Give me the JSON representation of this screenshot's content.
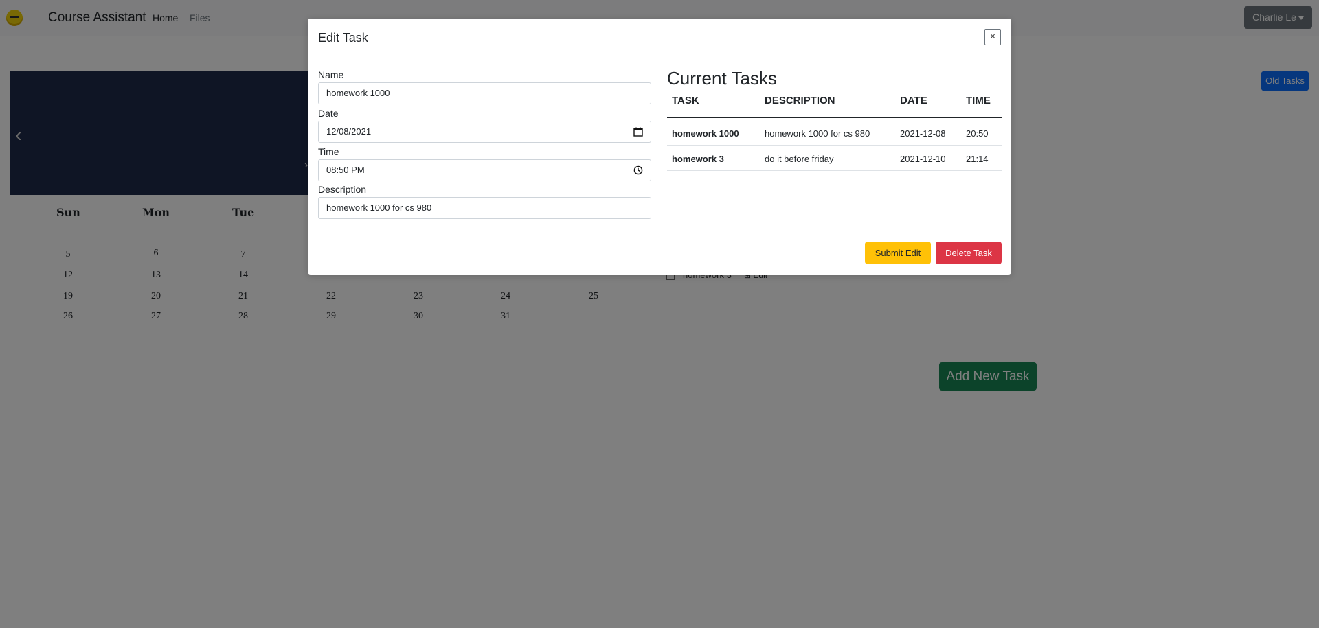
{
  "navbar": {
    "brand": "Course Assistant",
    "links": [
      "Home",
      "Files"
    ],
    "user": "Charlie Le"
  },
  "page": {
    "old_tasks_label": "Old Tasks",
    "add_task_label": "Add New Task",
    "prev_arrow": "‹",
    "next_arrow": "›",
    "calendar": {
      "weekdays": [
        "Sun",
        "Mon",
        "Tue"
      ],
      "days": [
        "5",
        "6",
        "7",
        "12",
        "13",
        "14",
        "19",
        "20",
        "21",
        "22",
        "23",
        "24",
        "25",
        "26",
        "27",
        "28",
        "29",
        "30",
        "31"
      ]
    },
    "behind_task": {
      "name": "homework 3",
      "edit_label": "Edit"
    }
  },
  "modal": {
    "title": "Edit Task",
    "close_label": "×",
    "fields": {
      "name": {
        "label": "Name",
        "value": "homework 1000"
      },
      "date": {
        "label": "Date",
        "value": "12/08/2021"
      },
      "time": {
        "label": "Time",
        "value": "08:50 PM"
      },
      "description": {
        "label": "Description",
        "value": "homework 1000 for cs 980"
      }
    },
    "current_tasks": {
      "title": "Current Tasks",
      "columns": [
        "TASK",
        "DESCRIPTION",
        "DATE",
        "TIME"
      ],
      "rows": [
        {
          "task": "homework 1000",
          "description": "homework 1000 for cs 980",
          "date": "2021-12-08",
          "time": "20:50"
        },
        {
          "task": "homework 3",
          "description": "do it before friday",
          "date": "2021-12-10",
          "time": "21:14"
        }
      ]
    },
    "submit_label": "Submit Edit",
    "delete_label": "Delete Task"
  },
  "colors": {
    "submit": "#ffc107",
    "delete": "#dc3545",
    "add_task": "#198754",
    "old_tasks": "#0d6efd",
    "banner": "#1f2a4a"
  }
}
